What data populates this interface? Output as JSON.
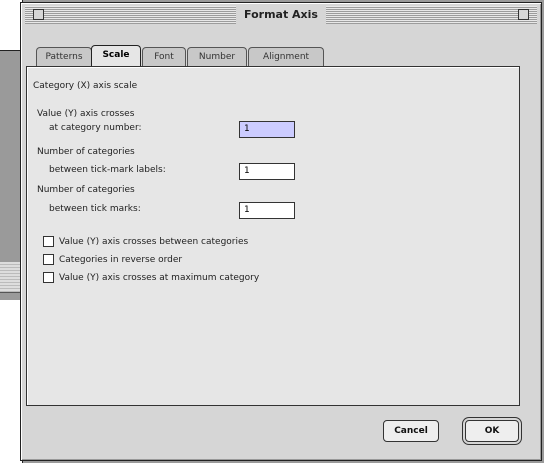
{
  "window": {
    "title": "Format Axis"
  },
  "tabs": [
    {
      "label": "Patterns",
      "active": false
    },
    {
      "label": "Scale",
      "active": true
    },
    {
      "label": "Font",
      "active": false
    },
    {
      "label": "Number",
      "active": false
    },
    {
      "label": "Alignment",
      "active": false
    }
  ],
  "scale": {
    "heading": "Category (X) axis scale",
    "crosses_label_1": "Value (Y) axis crosses",
    "crosses_label_2": "at category number:",
    "crosses_value": "1",
    "tick_labels_label_1": "Number of categories",
    "tick_labels_label_2": "between tick-mark labels:",
    "tick_labels_value": "1",
    "tick_marks_label_1": "Number of categories",
    "tick_marks_label_2": "between tick marks:",
    "tick_marks_value": "1",
    "checkboxes": [
      {
        "label": "Value (Y) axis crosses between categories",
        "checked": false
      },
      {
        "label": "Categories in reverse order",
        "checked": false
      },
      {
        "label": "Value (Y) axis crosses at maximum category",
        "checked": false
      }
    ]
  },
  "buttons": {
    "cancel": "Cancel",
    "ok": "OK"
  }
}
